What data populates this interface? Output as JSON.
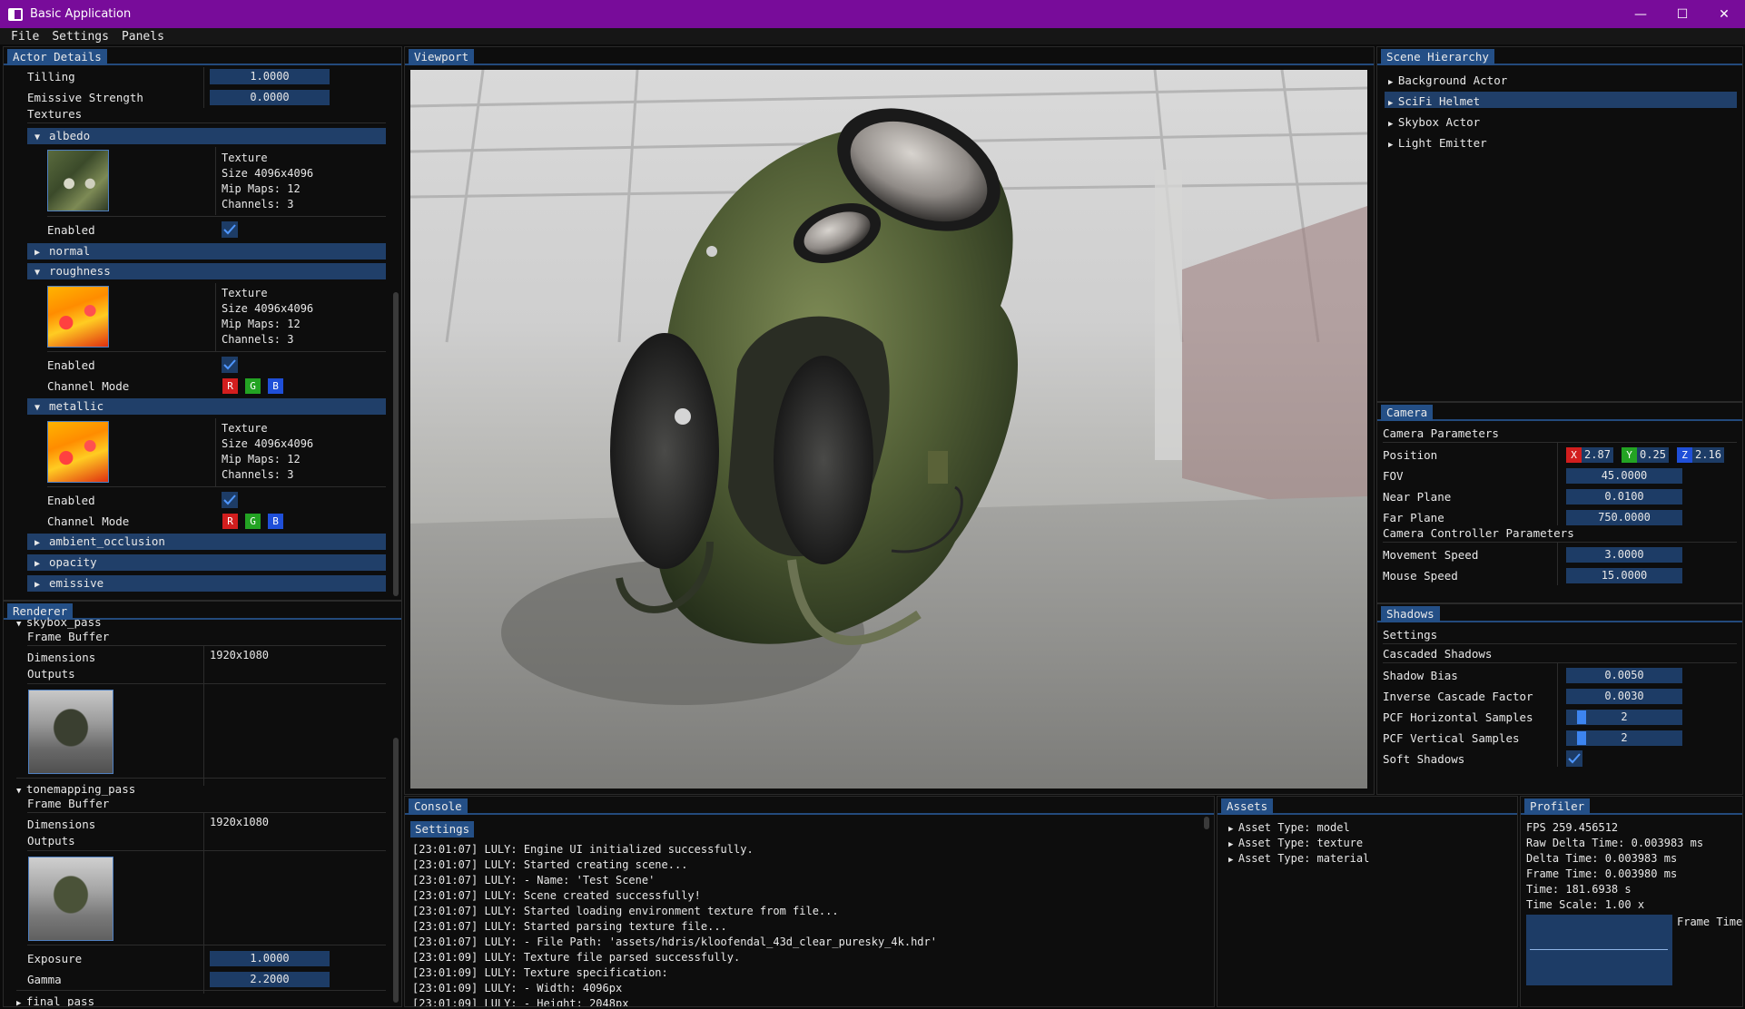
{
  "window": {
    "title": "Basic Application",
    "minimize": "—",
    "maximize": "☐",
    "close": "✕"
  },
  "menu": [
    "File",
    "Settings",
    "Panels"
  ],
  "actor_details": {
    "tab": "Actor Details",
    "tilling_label": "Tilling",
    "tilling_value": "1.0000",
    "emissive_label": "Emissive Strength",
    "emissive_value": "0.0000",
    "textures_label": "Textures",
    "sections": {
      "albedo": "albedo",
      "normal": "normal",
      "roughness": "roughness",
      "metallic": "metallic",
      "ambient_occlusion": "ambient_occlusion",
      "opacity": "opacity",
      "emissive": "emissive"
    },
    "tex_info": {
      "line1": "Texture",
      "line2": "Size 4096x4096",
      "line3": "Mip Maps: 12",
      "line4": "Channels: 3"
    },
    "enabled_label": "Enabled",
    "channel_mode_label": "Channel Mode",
    "channels": [
      "R",
      "G",
      "B"
    ]
  },
  "renderer": {
    "tab": "Renderer",
    "skybox_pass": "skybox_pass",
    "frame_buffer": "Frame Buffer",
    "dimensions_label": "Dimensions",
    "dimensions_value": "1920x1080",
    "outputs_label": "Outputs",
    "tonemapping_pass": "tonemapping_pass",
    "exposure_label": "Exposure",
    "exposure_value": "1.0000",
    "gamma_label": "Gamma",
    "gamma_value": "2.2000",
    "final_pass": "final_pass"
  },
  "viewport": {
    "tab": "Viewport"
  },
  "scene_hierarchy": {
    "tab": "Scene Hierarchy",
    "items": [
      "Background Actor",
      "SciFi Helmet",
      "Skybox Actor",
      "Light Emitter"
    ],
    "selected_index": 1
  },
  "camera": {
    "tab": "Camera",
    "params_label": "Camera Parameters",
    "position_label": "Position",
    "pos_x_label": "X",
    "pos_x": "2.87",
    "pos_y_label": "Y",
    "pos_y": "0.25",
    "pos_z_label": "Z",
    "pos_z": "2.16",
    "fov_label": "FOV",
    "fov": "45.0000",
    "near_label": "Near Plane",
    "near": "0.0100",
    "far_label": "Far Plane",
    "far": "750.0000",
    "controller_label": "Camera Controller Parameters",
    "move_label": "Movement Speed",
    "move": "3.0000",
    "mouse_label": "Mouse Speed",
    "mouse": "15.0000"
  },
  "shadows": {
    "tab": "Shadows",
    "settings_label": "Settings",
    "cascaded_label": "Cascaded Shadows",
    "bias_label": "Shadow Bias",
    "bias": "0.0050",
    "inv_label": "Inverse Cascade Factor",
    "inv": "0.0030",
    "pcf_h_label": "PCF Horizontal Samples",
    "pcf_h": "2",
    "pcf_v_label": "PCF Vertical Samples",
    "pcf_v": "2",
    "soft_label": "Soft Shadows"
  },
  "console": {
    "tab": "Console",
    "settings_button": "Settings",
    "lines": [
      "[23:01:07] LULY: Engine UI initialized successfully.",
      "[23:01:07] LULY: Started creating scene...",
      "[23:01:07] LULY:   - Name: 'Test Scene'",
      "[23:01:07] LULY: Scene created successfully!",
      "[23:01:07] LULY: Started loading environment texture from file...",
      "[23:01:07] LULY: Started parsing texture file...",
      "[23:01:07] LULY:   - File Path: 'assets/hdris/kloofendal_43d_clear_puresky_4k.hdr'",
      "[23:01:09] LULY: Texture file parsed successfully.",
      "[23:01:09] LULY: Texture specification:",
      "[23:01:09] LULY:   - Width: 4096px",
      "[23:01:09] LULY:   - Height: 2048px"
    ]
  },
  "assets": {
    "tab": "Assets",
    "items": [
      "Asset Type: model",
      "Asset Type: texture",
      "Asset Type: material"
    ]
  },
  "profiler": {
    "tab": "Profiler",
    "lines": [
      "FPS 259.456512",
      "Raw Delta Time: 0.003983 ms",
      "Delta Time: 0.003983 ms",
      "Frame Time: 0.003980 ms",
      "Time: 181.6938 s",
      "Time Scale: 1.00 x"
    ],
    "graph_label": "Frame Time"
  }
}
